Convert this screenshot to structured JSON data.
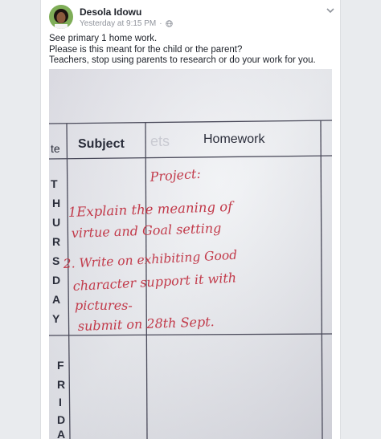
{
  "post": {
    "author": "Desola Idowu",
    "timestamp": "Yesterday at 9:15 PM",
    "separator": "·",
    "privacy_icon": "globe-icon",
    "options_icon": "chevron-down-icon",
    "lines": [
      "See primary 1 home work.",
      "Please is this meant for the child or the parent?",
      "Teachers, stop using parents to research or do your work for you."
    ]
  },
  "photo": {
    "table": {
      "col_date_fragment": "te",
      "col_subject": "Subject",
      "col_homework": "Homework",
      "faded_stamp": "ets"
    },
    "day_labels": {
      "thursday": [
        "T",
        "H",
        "U",
        "R",
        "S",
        "D",
        "A",
        "Y"
      ],
      "friday": [
        "F",
        "R",
        "I",
        "D",
        "A"
      ]
    },
    "handwriting": [
      "Project:",
      "1Explain the meaning of",
      "virtue and Goal setting",
      "2. Write on exhibiting Good",
      "character support it with",
      "pictures-",
      "submit on 28th Sept."
    ]
  }
}
